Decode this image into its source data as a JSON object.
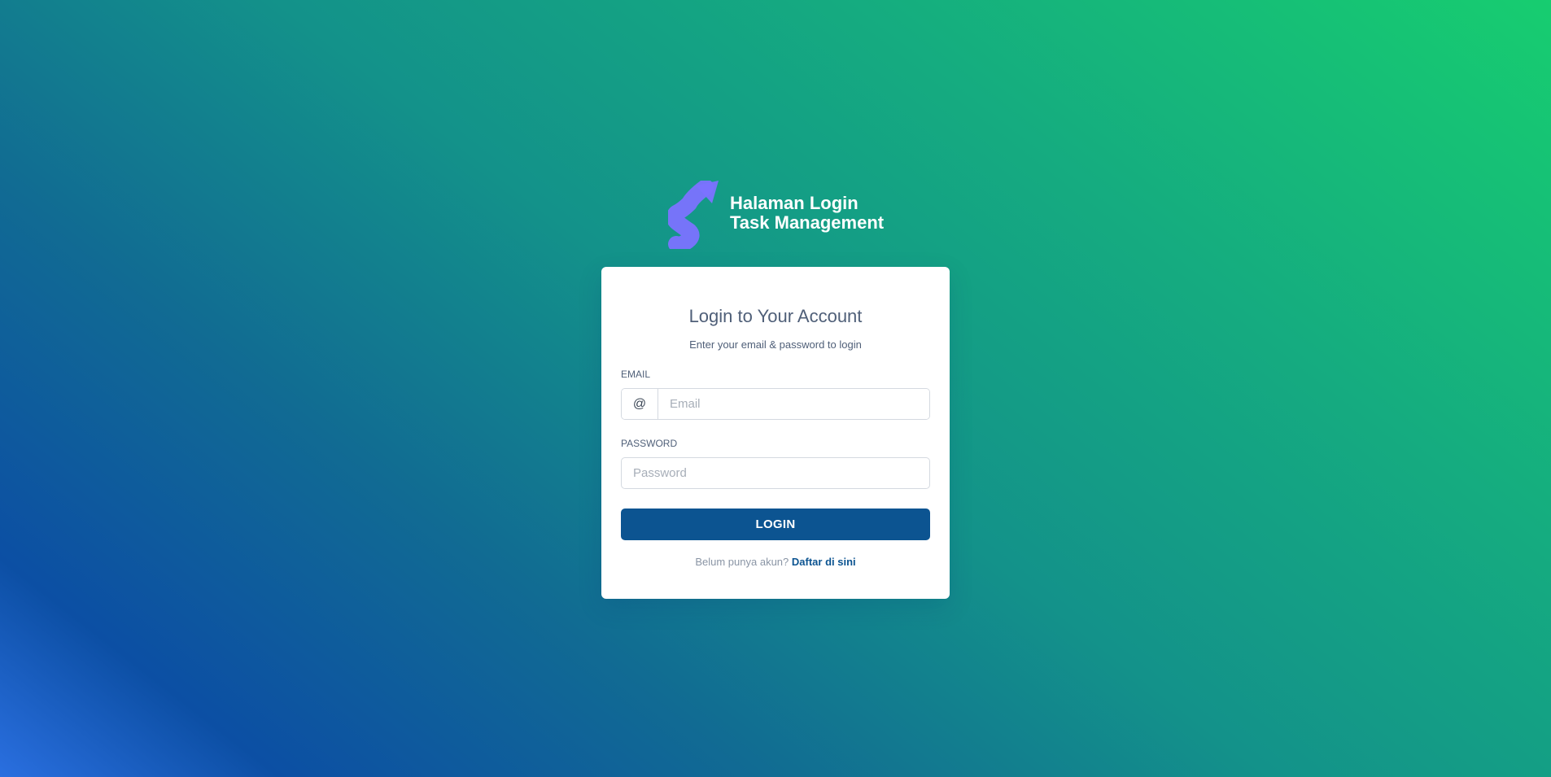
{
  "brand": {
    "logo_icon": "s-arrow-logo-icon",
    "title_line1": "Halaman Login",
    "title_line2": "Task Management"
  },
  "login_card": {
    "title": "Login to Your Account",
    "subtitle": "Enter your email & password to login",
    "email": {
      "label": "EMAIL",
      "prefix": "@",
      "placeholder": "Email",
      "value": ""
    },
    "password": {
      "label": "PASSWORD",
      "placeholder": "Password",
      "value": ""
    },
    "login_button": "LOGIN",
    "signup_prompt": "Belum punya akun?",
    "signup_link": "Daftar di sini"
  },
  "colors": {
    "button": "#0c5491",
    "logo": "#7b72ff",
    "gradient_start": "#2a6fe0",
    "gradient_end": "#17cd70"
  }
}
